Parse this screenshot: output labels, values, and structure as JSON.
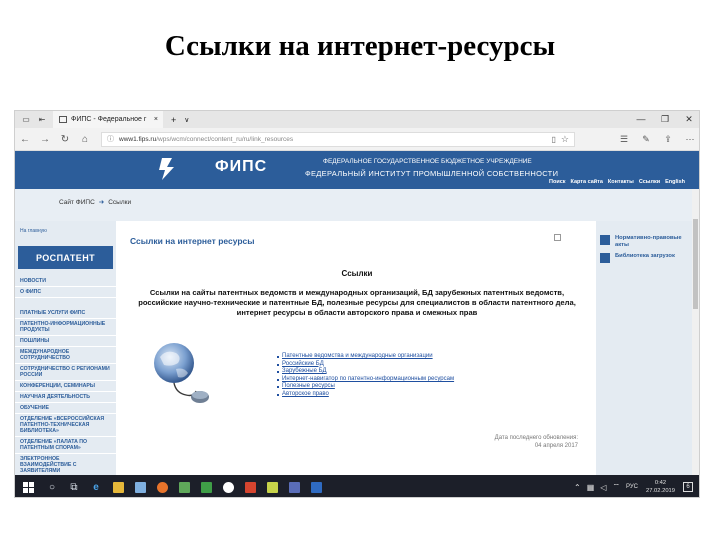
{
  "slide": {
    "title": "Ссылки на интернет-ресурсы"
  },
  "browser": {
    "tab_title": "ФИПС - Федеральное г",
    "url_host": "www1.fips.ru",
    "url_path": "/wps/wcm/connect/content_ru/ru/link_resources"
  },
  "site": {
    "logo_text": "ФИПС",
    "inst_line1": "ФЕДЕРАЛЬНОЕ ГОСУДАРСТВЕННОЕ БЮДЖЕТНОЕ УЧРЕЖДЕНИЕ",
    "inst_line2": "ФЕДЕРАЛЬНЫЙ ИНСТИТУТ ПРОМЫШЛЕННОЙ СОБСТВЕННОСТИ",
    "top_menu": [
      "Поиск",
      "Карта сайта",
      "Контакты",
      "Ссылки",
      "English"
    ],
    "breadcrumb": {
      "home": "Сайт ФИПС",
      "current": "Ссылки"
    },
    "home_link": "На главную",
    "rospatent": "РОСПАТЕНТ",
    "left_menu": [
      "НОВОСТИ",
      "О ФИПС",
      "ПЛАТНЫЕ УСЛУГИ ФИПС",
      "ПАТЕНТНО-ИНФОРМАЦИОННЫЕ ПРОДУКТЫ",
      "ПОШЛИНЫ",
      "МЕЖДУНАРОДНОЕ СОТРУДНИЧЕСТВО",
      "СОТРУДНИЧЕСТВО С РЕГИОНАМИ РОССИИ",
      "КОНФЕРЕНЦИИ, СЕМИНАРЫ",
      "НАУЧНАЯ ДЕЯТЕЛЬНОСТЬ",
      "ОБУЧЕНИЕ",
      "ОТДЕЛЕНИЕ «ВСЕРОССИЙСКАЯ ПАТЕНТНО-ТЕХНИЧЕСКАЯ БИБЛИОТЕКА»",
      "ОТДЕЛЕНИЕ «ПАЛАТА ПО ПАТЕНТНЫМ СПОРАМ»",
      "ЭЛЕКТРОННОЕ ВЗАИМОДЕЙСТВИЕ С ЗАЯВИТЕЛЯМИ"
    ],
    "main_heading": "Ссылки на интернет ресурсы",
    "section_title": "Ссылки",
    "section_desc": "Ссылки на сайты патентных ведомств и международных организаций, БД зарубежных патентных ведомств, российские научно-технические и патентные БД, полезные ресурсы для специалистов в области патентного дела, интернет ресурсы в области авторского права и смежных прав",
    "links": [
      "Патентные ведомства и международные организации",
      "Российские БД",
      "Зарубежные БД",
      "Интернет-навигатор по патентно-информационным ресурсам",
      "Полезные ресурсы",
      "Авторское право"
    ],
    "update_label": "Дата последнего обновления:",
    "update_date": "04 апреля 2017",
    "right_links": [
      "Нормативно-правовые акты",
      "Библиотека загрузок"
    ]
  },
  "taskbar": {
    "lang": "РУС",
    "time": "0:42",
    "date": "27.02.2019",
    "notifications": "6"
  },
  "colors": {
    "header": "#2c5d9a",
    "taskbar": "#1c1f29",
    "link": "#1f4fa0"
  }
}
